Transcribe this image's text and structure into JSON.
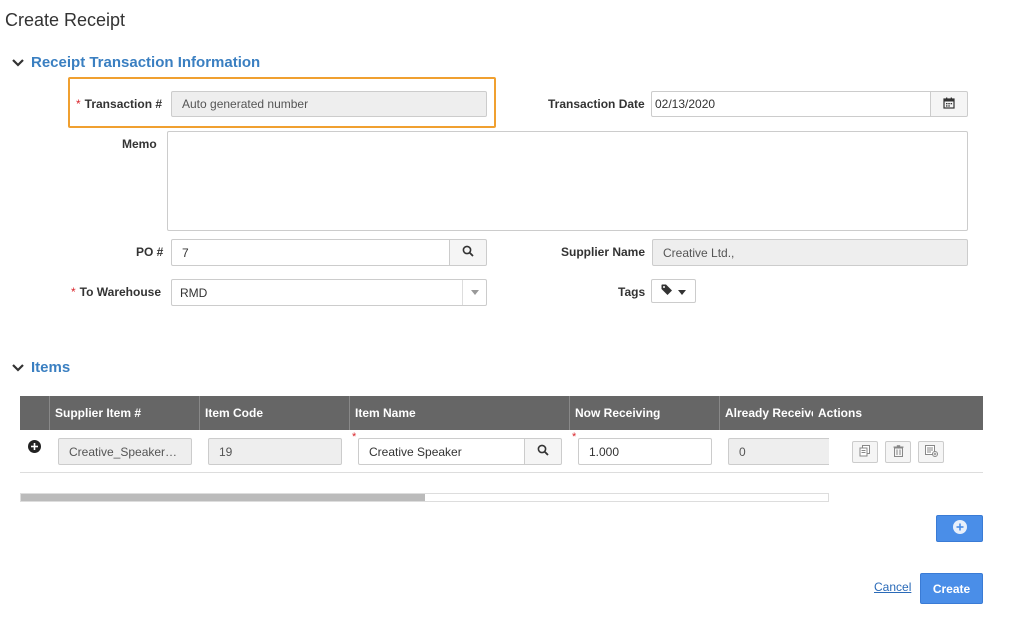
{
  "page": {
    "title": "Create Receipt"
  },
  "sections": {
    "transaction": {
      "title": "Receipt Transaction Information"
    },
    "items": {
      "title": "Items"
    }
  },
  "form": {
    "transaction_no": {
      "label": "Transaction #",
      "value": "Auto generated number"
    },
    "transaction_date": {
      "label": "Transaction Date",
      "value": "02/13/2020"
    },
    "memo": {
      "label": "Memo",
      "value": ""
    },
    "po_no": {
      "label": "PO #",
      "value": "7"
    },
    "supplier_name": {
      "label": "Supplier Name",
      "value": "Creative Ltd.,"
    },
    "to_warehouse": {
      "label": "To Warehouse",
      "value": "RMD"
    },
    "tags": {
      "label": "Tags"
    }
  },
  "items_table": {
    "columns": [
      "Supplier Item #",
      "Item Code",
      "Item Name",
      "Now Receiving",
      "Already Received",
      "Actions"
    ],
    "rows": [
      {
        "supplier_item": "Creative_Speaker…",
        "item_code": "19",
        "item_name": "Creative Speaker",
        "now_receiving": "1.000",
        "already_received": "0"
      }
    ],
    "scroll_position": 0.5
  },
  "footer": {
    "cancel_label": "Cancel",
    "create_label": "Create"
  },
  "colors": {
    "accent": "#4a8ee8",
    "section_title": "#3a7fc1",
    "highlight": "#f0a030",
    "required": "#d9262c"
  },
  "icons": {
    "collapse": "chevron-down-icon",
    "calendar": "calendar-icon",
    "search": "search-icon",
    "dropdown": "caret-down-icon",
    "tag": "tag-icon",
    "add_row": "plus-circle-icon",
    "expand_row": "plus-circle-icon",
    "copy": "copy-icon",
    "delete": "trash-icon",
    "details": "details-icon"
  }
}
